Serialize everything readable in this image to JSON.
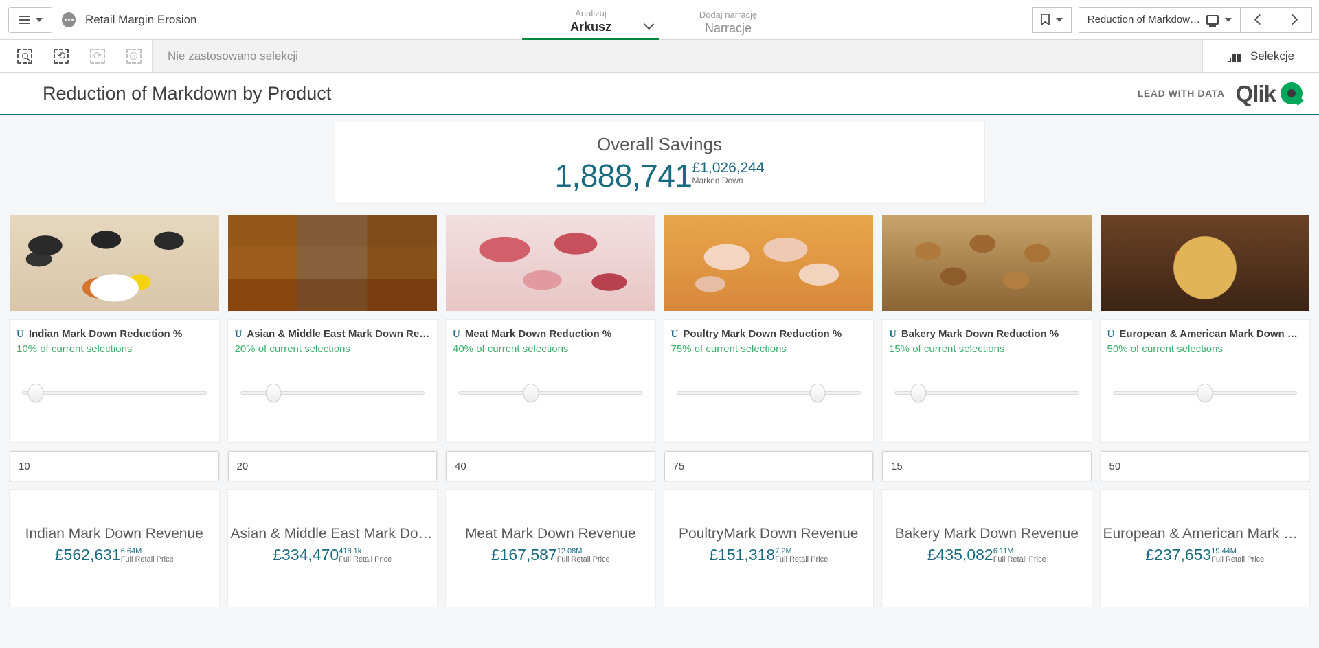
{
  "topnav": {
    "menu_icon": "hamburger-icon",
    "app_icon": "app-dots-icon",
    "app_title": "Retail Margin Erosion",
    "tabs": [
      {
        "sub": "Analizuj",
        "main": "Arkusz",
        "active": true
      },
      {
        "sub": "Dodaj narrację",
        "main": "Narracje",
        "active": false
      }
    ],
    "bookmark_label": "",
    "sheet_selector": "Reduction of Markdow…",
    "prev_label": "‹",
    "next_label": "›"
  },
  "selbar": {
    "tools": [
      "selection-search-icon",
      "step-back-icon",
      "step-forward-icon",
      "clear-selections-icon"
    ],
    "message": "Nie zastosowano selekcji",
    "selections_label": "Selekcje"
  },
  "sheet": {
    "title": "Reduction of Markdown by Product",
    "brand_tagline": "LEAD WITH DATA",
    "brand_name": "Qlik"
  },
  "kpi_overall": {
    "title": "Overall Savings",
    "value": "1,888,741",
    "secondary_value": "£1,026,244",
    "secondary_label": "Marked Down"
  },
  "columns": [
    {
      "image": "indian-food-image",
      "variable_label": "Indian Mark Down Reduction %",
      "variable_sub": "10% of current selections",
      "slider_percent": 10,
      "input_value": "10",
      "revenue_title": "Indian Mark Down Revenue",
      "revenue_value": "£562,631",
      "revenue_secondary_value": "6.64M",
      "revenue_secondary_label": "Full Retail Price"
    },
    {
      "image": "asian-middle-east-food-image",
      "variable_label": "Asian & Middle East Mark Down Redu…",
      "variable_sub": "20% of current selections",
      "slider_percent": 20,
      "input_value": "20",
      "revenue_title": "Asian & Middle East Mark Down …",
      "revenue_value": "£334,470",
      "revenue_secondary_value": "418.1k",
      "revenue_secondary_label": "Full Retail Price"
    },
    {
      "image": "meat-image",
      "variable_label": "Meat Mark Down Reduction %",
      "variable_sub": "40% of current selections",
      "slider_percent": 40,
      "input_value": "40",
      "revenue_title": "Meat Mark Down Revenue",
      "revenue_value": "£167,587",
      "revenue_secondary_value": "12.08M",
      "revenue_secondary_label": "Full Retail Price"
    },
    {
      "image": "poultry-image",
      "variable_label": "Poultry Mark Down Reduction %",
      "variable_sub": "75% of current selections",
      "slider_percent": 75,
      "input_value": "75",
      "revenue_title": "PoultryMark Down Revenue",
      "revenue_value": "£151,318",
      "revenue_secondary_value": "7.2M",
      "revenue_secondary_label": "Full Retail Price"
    },
    {
      "image": "bakery-image",
      "variable_label": "Bakery Mark Down Reduction %",
      "variable_sub": "15% of current selections",
      "slider_percent": 15,
      "input_value": "15",
      "revenue_title": "Bakery Mark Down Revenue",
      "revenue_value": "£435,082",
      "revenue_secondary_value": "6.11M",
      "revenue_secondary_label": "Full Retail Price"
    },
    {
      "image": "european-american-pizza-image",
      "variable_label": "European & American Mark Down Re…",
      "variable_sub": "50% of current selections",
      "slider_percent": 50,
      "input_value": "50",
      "revenue_title": "European & American Mark Do…",
      "revenue_value": "£237,653",
      "revenue_secondary_value": "19.44M",
      "revenue_secondary_label": "Full Retail Price"
    }
  ],
  "colors": {
    "accent_teal": "#1a6a82",
    "accent_green": "#00873d",
    "sub_green": "#3cae6b",
    "qlik_green": "#00a65a",
    "sheet_border": "#00708c"
  }
}
